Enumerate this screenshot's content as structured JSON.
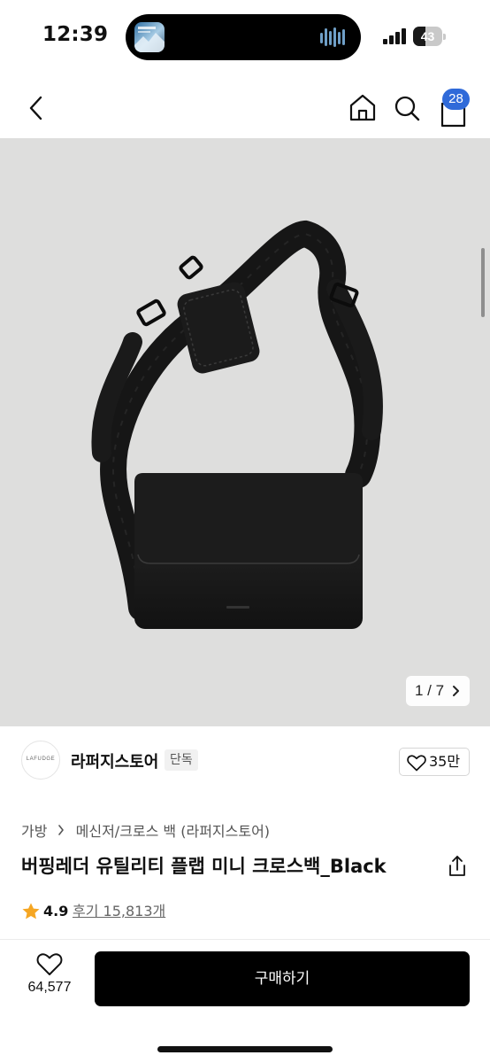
{
  "status_bar": {
    "time": "12:39",
    "battery_level": "43",
    "battery_fraction": 0.43
  },
  "nav": {
    "icons": [
      "back-chevron-icon",
      "home-icon",
      "search-icon",
      "shopping-bag-icon"
    ],
    "cart_count": "28",
    "badge_color": "#2f6ad9"
  },
  "gallery": {
    "page_counter": "1 / 7",
    "next_icon": "chevron-right-icon",
    "background_color": "#dededd"
  },
  "store": {
    "logo_text": "LAFUDGE",
    "name": "라퍼지스토어",
    "badge": "단독",
    "likes": "35만"
  },
  "breadcrumb": {
    "category": "가방",
    "subcategory": "메신저/크로스 백 (라퍼지스토어)"
  },
  "product": {
    "title": "버핑레더 유틸리티 플랩 미니 크로스백_Black",
    "rating": "4.9",
    "reviews": "후기 15,813개",
    "star_color": "#f5a623"
  },
  "bottom_bar": {
    "wish_count": "64,577",
    "buy_label": "구매하기"
  }
}
